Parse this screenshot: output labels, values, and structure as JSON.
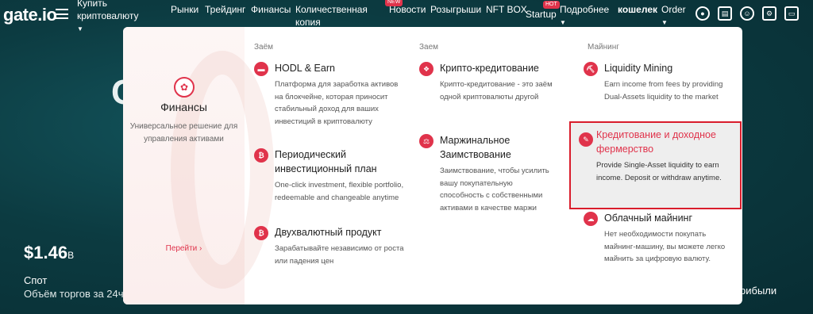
{
  "background": {
    "hero_letter": "C",
    "price": "$1.46",
    "price_suffix": "B",
    "spot_label": "Спот",
    "volume_label": "Объём торгов за 24ч",
    "right_text": "рибыли"
  },
  "nav": {
    "logo": "gate.io",
    "items": [
      {
        "label": "Купить криптовалюту",
        "line2": "",
        "caret": true
      },
      {
        "label": "Рынки"
      },
      {
        "label": "Трейдинг"
      },
      {
        "label": "Финансы"
      },
      {
        "label": "Количественная",
        "line2": "копия"
      },
      {
        "label": "Новости",
        "badge": "NEW"
      },
      {
        "label": "Розыгрыши"
      },
      {
        "label": "NFT BOX"
      },
      {
        "label": "Startup",
        "badge": "HOT"
      },
      {
        "label": "Подробнее"
      },
      {
        "label": "кошелек"
      },
      {
        "label": "Order"
      }
    ],
    "icons": [
      "user-icon",
      "app-download-icon",
      "support-icon",
      "settings-icon",
      "display-icon"
    ]
  },
  "panel": {
    "left": {
      "icon": "finance-icon",
      "title": "Финансы",
      "desc": "Универсальное решение для управления активами",
      "link": "Перейти ›"
    },
    "col1": {
      "header": "Заём",
      "items": [
        {
          "icon": "hodl-icon",
          "title": "HODL & Earn",
          "desc": "Платформа для заработка активов на блокчейне, которая приносит стабильный доход для ваших инвестиций в криптовалюту"
        },
        {
          "icon": "periodic-plan-icon",
          "title": "Периодический инвестиционный план",
          "desc": "One-click investment, flexible portfolio, redeemable and changeable anytime"
        },
        {
          "icon": "dual-currency-icon",
          "title": "Двухвалютный продукт",
          "desc": "Зарабатывайте независимо от роста или падения цен"
        }
      ]
    },
    "col2": {
      "header": "Заем",
      "items": [
        {
          "icon": "crypto-lending-icon",
          "title": "Крипто-кредитование",
          "desc": "Крипто-кредитование - это заём одной криптовалюты другой"
        },
        {
          "icon": "margin-borrow-icon",
          "title": "Маржинальное Заимствование",
          "desc": "Заимствование, чтобы усилить вашу покупательную способность с собственными активами в качестве маржи"
        }
      ]
    },
    "col3": {
      "header": "Майнинг",
      "items": [
        {
          "icon": "liquidity-mining-icon",
          "title": "Liquidity Mining",
          "desc": "Earn income from fees by providing Dual-Assets liquidity to the market"
        },
        {
          "icon": "lending-farming-icon",
          "title": "Кредитование и доходное фермерство",
          "desc": "Provide Single-Asset liquidity to earn income. Deposit or withdraw anytime."
        },
        {
          "icon": "cloud-mining-icon",
          "title": "Облачный майнинг",
          "desc": "Нет необходимости покупать майнинг-машину, вы можете легко майнить за цифровую валюту."
        }
      ]
    }
  }
}
